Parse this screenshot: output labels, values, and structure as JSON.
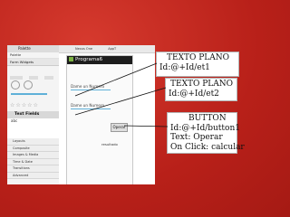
{
  "screenshot": {
    "palette": {
      "title": "Palette",
      "header_items": [
        "Palette",
        "Form Widgets"
      ],
      "text_fields_label": "Text Fields",
      "text_fields_sample": "abc",
      "categories": [
        "Layouts",
        "Composite",
        "Images & Media",
        "Time & Date",
        "Transitions",
        "Advanced"
      ]
    },
    "toolbar": {
      "device": "Nexus One",
      "api": "AppT"
    },
    "phone": {
      "app_title": "Programa6",
      "hint1": "Dame un Numero",
      "hint2": "Dame un Numero",
      "button_text": "Operar",
      "result_label": "resultado"
    }
  },
  "annotations": [
    {
      "lines": [
        "TEXTO PLANO",
        "Id:@+Id/et1"
      ]
    },
    {
      "lines": [
        "TEXTO PLANO",
        "Id:@+Id/et2"
      ]
    },
    {
      "lines": [
        "BUTTON",
        "Id:@+Id/button1",
        "Text: Operar",
        "On Click: calcular"
      ]
    }
  ]
}
